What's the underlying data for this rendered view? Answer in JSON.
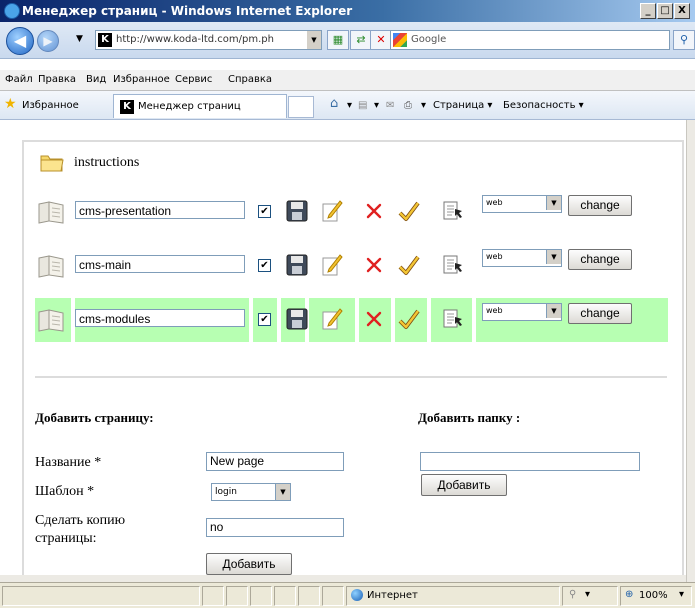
{
  "window": {
    "title": "Менеджер страниц - Windows Internet Explorer",
    "minimize": "_",
    "maximize": "□",
    "close": "X"
  },
  "addressbar": {
    "url": "http://www.koda-ltd.com/pm.ph",
    "search_placeholder": "Google"
  },
  "menu": {
    "items": [
      "Файл",
      "Правка",
      "Вид",
      "Избранное",
      "Сервис",
      "Справка"
    ]
  },
  "favbar": {
    "favorites_label": "Избранное",
    "tab_title": "Менеджер страниц",
    "page_label": "Страница ▾",
    "security_label": "Безопасность ▾"
  },
  "folder": {
    "name": "instructions"
  },
  "pages": [
    {
      "name": "cms-presentation",
      "checked": "✔",
      "template": "web",
      "highlighted": false
    },
    {
      "name": "cms-main",
      "checked": "✔",
      "template": "web",
      "highlighted": false
    },
    {
      "name": "cms-modules",
      "checked": "✔",
      "template": "web",
      "highlighted": true
    }
  ],
  "page_action_label": "change",
  "add_page": {
    "heading": "Добавить страницу:",
    "name_label": "Название *",
    "name_value": "New page",
    "template_label": "Шаблон *",
    "template_value": "login",
    "copy_label": "Сделать копию страницы:",
    "copy_value": "no",
    "submit_label": "Добавить"
  },
  "add_folder": {
    "heading": "Добавить папку :",
    "name_value": "",
    "submit_label": "Добавить"
  },
  "statusbar": {
    "zone": "Интернет",
    "zoom": "100%"
  },
  "colors": {
    "highlight_row": "#b7ffb2",
    "titlebar": "#0a246a",
    "delete_icon": "#e02020"
  }
}
